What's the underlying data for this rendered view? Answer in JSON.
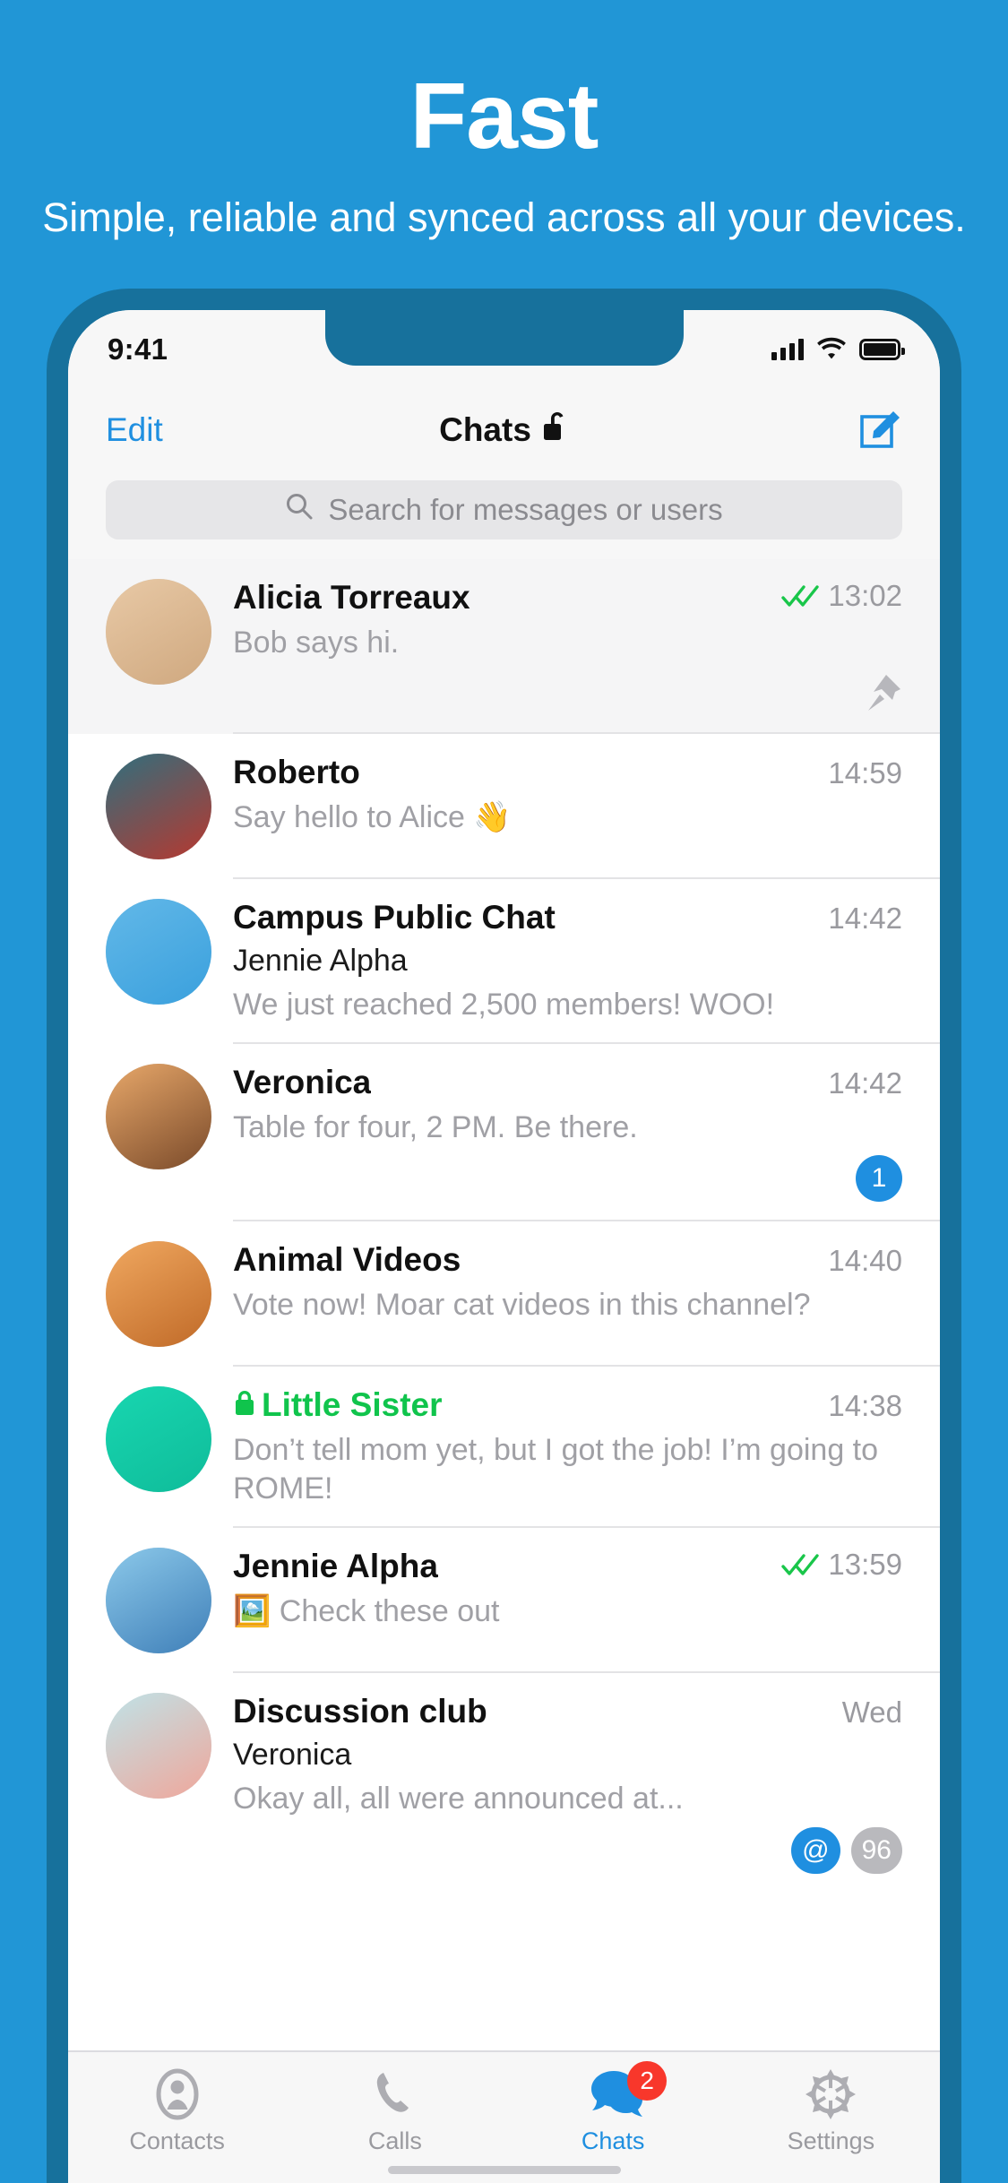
{
  "promo": {
    "title": "Fast",
    "subtitle": "Simple, reliable and synced across all your devices."
  },
  "colors": {
    "background": "#2196d6",
    "accent": "#1f8fe0",
    "secret_green": "#10c44c",
    "badge_red": "#f8372b",
    "badge_gray": "#b9b9bd"
  },
  "status_bar": {
    "time": "9:41",
    "signal_icon": "signal-bars-icon",
    "wifi_icon": "wifi-icon",
    "battery_icon": "battery-full-icon"
  },
  "nav_bar": {
    "edit_label": "Edit",
    "title": "Chats",
    "title_lock_icon": "unlocked-padlock-icon",
    "compose_icon": "compose-icon"
  },
  "search": {
    "placeholder": "Search for messages or users",
    "icon": "search-icon"
  },
  "chats": [
    {
      "name": "Alicia Torreaux",
      "sender": "",
      "preview": "Bob says hi.",
      "time": "13:02",
      "read_status": "double-check-icon",
      "pinned": true,
      "secret": false,
      "badges": [],
      "selected": true,
      "avatar_colors": [
        "#e8c9a6",
        "#cfa87f"
      ]
    },
    {
      "name": "Roberto",
      "sender": "",
      "preview": "Say hello to Alice 👋",
      "time": "14:59",
      "read_status": "",
      "pinned": false,
      "secret": false,
      "badges": [],
      "selected": false,
      "avatar_colors": [
        "#2f6f7e",
        "#b8382f"
      ]
    },
    {
      "name": "Campus Public Chat",
      "sender": "Jennie Alpha",
      "preview": "We just reached 2,500 members! WOO!",
      "time": "14:42",
      "read_status": "",
      "pinned": false,
      "secret": false,
      "badges": [],
      "selected": false,
      "avatar_colors": [
        "#62b8e8",
        "#3aa0dd"
      ]
    },
    {
      "name": "Veronica",
      "sender": "",
      "preview": "Table for four, 2 PM. Be there.",
      "time": "14:42",
      "read_status": "",
      "pinned": false,
      "secret": false,
      "badges": [
        {
          "text": "1",
          "style": "blue"
        }
      ],
      "selected": false,
      "avatar_colors": [
        "#e8a86a",
        "#7a4a2a"
      ]
    },
    {
      "name": "Animal Videos",
      "sender": "",
      "preview": "Vote now! Moar cat videos in this channel?",
      "time": "14:40",
      "read_status": "",
      "pinned": false,
      "secret": false,
      "badges": [],
      "selected": false,
      "avatar_colors": [
        "#f0a860",
        "#c06a28"
      ]
    },
    {
      "name": "Little Sister",
      "sender": "",
      "preview": "Don’t tell mom yet, but I got the job! I’m going to ROME!",
      "time": "14:38",
      "read_status": "",
      "pinned": false,
      "secret": true,
      "badges": [],
      "selected": false,
      "avatar_colors": [
        "#18d6b0",
        "#0fbc9a"
      ]
    },
    {
      "name": "Jennie Alpha",
      "sender": "",
      "preview": "🖼️ Check these out",
      "time": "13:59",
      "read_status": "double-check-icon",
      "pinned": false,
      "secret": false,
      "badges": [],
      "selected": false,
      "avatar_colors": [
        "#8cc9ea",
        "#3f7fb8"
      ]
    },
    {
      "name": "Discussion club",
      "sender": "Veronica",
      "preview": "Okay all, all were announced at...",
      "time": "Wed",
      "read_status": "",
      "pinned": false,
      "secret": false,
      "badges": [
        {
          "text": "@",
          "style": "blue"
        },
        {
          "text": "96",
          "style": "gray"
        }
      ],
      "selected": false,
      "avatar_colors": [
        "#bfe3e8",
        "#f0a69a"
      ]
    }
  ],
  "tab_bar": [
    {
      "label": "Contacts",
      "icon": "contacts-icon",
      "active": false,
      "badge": ""
    },
    {
      "label": "Calls",
      "icon": "phone-icon",
      "active": false,
      "badge": ""
    },
    {
      "label": "Chats",
      "icon": "chat-bubbles-icon",
      "active": true,
      "badge": "2"
    },
    {
      "label": "Settings",
      "icon": "gear-icon",
      "active": false,
      "badge": ""
    }
  ]
}
